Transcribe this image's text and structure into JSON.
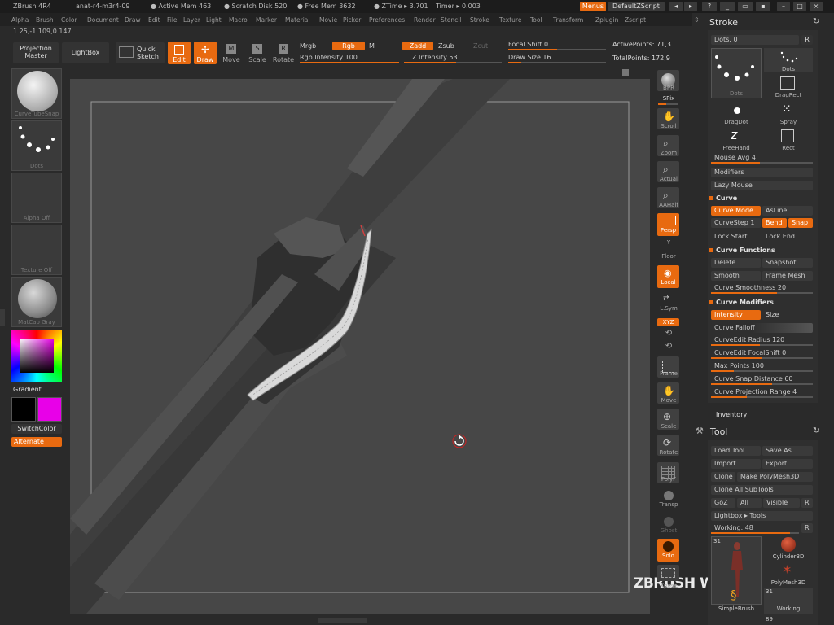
{
  "titlebar": {
    "app": "ZBrush 4R4",
    "doc": "anat-r4-m3r4-09",
    "active_mem": "● Active Mem 463",
    "scratch": "● Scratch Disk 520",
    "free_mem": "● Free Mem 3632",
    "ztime": "● ZTime ▸ 3.701",
    "timer": "Timer ▸ 0.003",
    "menus_btn": "Menus",
    "script_btn": "DefaultZScript"
  },
  "menubar": [
    "Alpha",
    "Brush",
    "Color",
    "Document",
    "Draw",
    "Edit",
    "File",
    "Layer",
    "Light",
    "Macro",
    "Marker",
    "Material",
    "Movie",
    "Picker",
    "Preferences",
    "Render",
    "Stencil",
    "Stroke",
    "Texture",
    "Tool",
    "Transform",
    "Zplugin",
    "Zscript"
  ],
  "coords": "1.25,-1.109,0.147",
  "toolbar": {
    "projection_master": "Projection Master",
    "lightbox": "LightBox",
    "quick_sketch": "Quick Sketch",
    "edit": "Edit",
    "draw": "Draw",
    "move": "Move",
    "scale": "Scale",
    "rotate": "Rotate",
    "mrgb": "Mrgb",
    "rgb": "Rgb",
    "m": "M",
    "rgb_intensity": "Rgb Intensity 100",
    "zadd": "Zadd",
    "zsub": "Zsub",
    "zcut": "Zcut",
    "z_intensity": "Z Intensity 53",
    "focal_shift": "Focal Shift 0",
    "draw_size": "Draw Size 16",
    "active_points": "ActivePoints: 71,3",
    "total_points": "TotalPoints: 172,9"
  },
  "left_shelf": {
    "brush": "CurveTubeSnap",
    "stroke": "Dots",
    "alpha": "Alpha Off",
    "texture": "Texture Off",
    "material": "MatCap Gray",
    "gradient": "Gradient",
    "switch_color": "SwitchColor",
    "alternate": "Alternate"
  },
  "right_shelf": [
    "BPR",
    "SPix",
    "Scroll",
    "Zoom",
    "Actual",
    "AAHalf",
    "Persp",
    "Floor",
    "Local",
    "L.Sym",
    "XYZ",
    "Frame",
    "Move",
    "Scale",
    "Rotate",
    "PolyF",
    "Transp",
    "Ghost",
    "Solo",
    "Xpose"
  ],
  "stroke_palette": {
    "title": "Stroke",
    "dots_value": "Dots. 0",
    "r": "R",
    "thumbs": [
      "Dots",
      "Dots",
      "DragRect",
      "DragDot",
      "Spray",
      "FreeHand",
      "Rect"
    ],
    "mouse_avg": "Mouse Avg 4",
    "modifiers": "Modifiers",
    "lazy_mouse": "Lazy Mouse",
    "curve": "Curve",
    "curve_mode": "Curve Mode",
    "asline": "AsLine",
    "curvestep": "CurveStep 1",
    "bend": "Bend",
    "snap": "Snap",
    "lock_start": "Lock Start",
    "lock_end": "Lock End",
    "curve_functions": "Curve Functions",
    "delete": "Delete",
    "snapshot": "Snapshot",
    "smooth": "Smooth",
    "frame_mesh": "Frame Mesh",
    "curve_smoothness": "Curve Smoothness 20",
    "curve_modifiers": "Curve Modifiers",
    "intensity": "Intensity",
    "size": "Size",
    "curve_falloff": "Curve Falloff",
    "curveedit_radius": "CurveEdit Radius 120",
    "curveedit_focalshift": "CurveEdit FocalShift 0",
    "max_points": "Max Points 100",
    "curve_snap_distance": "Curve Snap Distance 60",
    "curve_projection_range": "Curve Projection Range 4"
  },
  "inventory": "Inventory",
  "tool_palette": {
    "title": "Tool",
    "load_tool": "Load Tool",
    "save_as": "Save As",
    "import": "Import",
    "export": "Export",
    "clone": "Clone",
    "make_polymesh": "Make PolyMesh3D",
    "clone_all": "Clone All SubTools",
    "goz": "GoZ",
    "all": "All",
    "visible": "Visible",
    "r": "R",
    "lightbox_tools": "Lightbox ▸ Tools",
    "working": "Working. 48",
    "thumb_count1": "31",
    "thumb_cylinder": "Cylinder3D",
    "thumb_polymesh": "PolyMesh3D",
    "thumb_simplebrush": "SimpleBrush",
    "thumb_count2": "31",
    "thumb_working": "Working",
    "thumb_count3": "89"
  },
  "watermark": "ZBRUSH WORKSHOPS",
  "colors": {
    "accent": "#e86a10",
    "secondary_color": "#e800e8",
    "primary_color": "#000000"
  }
}
